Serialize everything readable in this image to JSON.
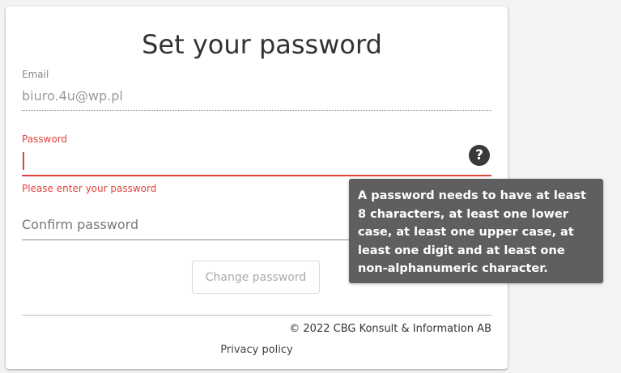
{
  "form": {
    "title": "Set your password",
    "email": {
      "label": "Email",
      "value": "biuro.4u@wp.pl"
    },
    "password": {
      "label": "Password",
      "error": "Please enter your password",
      "help_icon_glyph": "?"
    },
    "confirm_password": {
      "placeholder": "Confirm password"
    },
    "submit_label": "Change password"
  },
  "tooltip": {
    "text": "A password needs to have at least 8 characters, at least one lower case, at least one upper case, at least one digit and at least one non-alphanumeric character."
  },
  "footer": {
    "copyright": "© 2022 CBG Konsult & Information AB",
    "privacy_link": "Privacy policy"
  },
  "colors": {
    "error": "#e0443e",
    "tooltip_bg": "#5f5f5f",
    "card_bg": "#ffffff"
  },
  "icons": {
    "help": "question-mark-circle-icon"
  }
}
